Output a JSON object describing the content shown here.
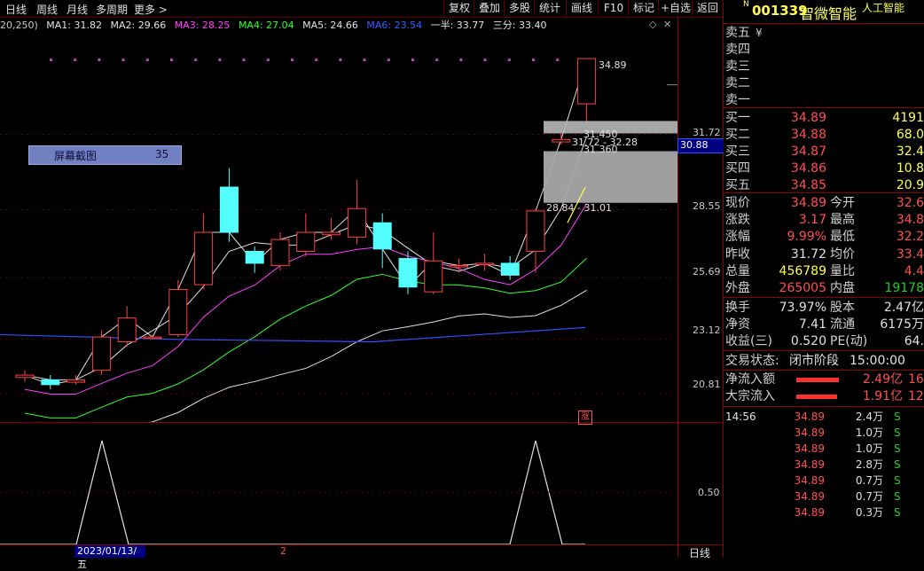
{
  "toolbar": {
    "left_items": [
      "日线",
      "周线",
      "月线",
      "多周期",
      "更多 >"
    ],
    "buttons": [
      "复权",
      "叠加",
      "多股",
      "统计",
      "画线",
      "F10",
      "标记",
      "+自选",
      "返回"
    ]
  },
  "indicators": {
    "prefix": "20,250)",
    "items": [
      {
        "label": "MA1: 31.82",
        "color": "#e0e0e0"
      },
      {
        "label": "MA2: 29.66",
        "color": "#e0e0e0"
      },
      {
        "label": "MA3: 28.25",
        "color": "#ff40ff"
      },
      {
        "label": "MA4: 27.04",
        "color": "#30ff30"
      },
      {
        "label": "MA5: 24.66",
        "color": "#e0e0e0"
      },
      {
        "label": "MA6: 23.54",
        "color": "#3060ff"
      },
      {
        "label": "一半: 33.77",
        "color": "#e0e0e0"
      },
      {
        "label": "三分: 33.40",
        "color": "#e0e0e0"
      }
    ]
  },
  "price_axis": {
    "labels": [
      "31.72",
      "30.88",
      "28.55",
      "25.69",
      "23.12",
      "20.81"
    ]
  },
  "sub_axis": {
    "label": "0.50"
  },
  "annotations": {
    "high": "34.89",
    "level1": "31.450",
    "level2": "31.72 - 32.28",
    "level3": "31.360",
    "range": "28.84 - 31.01",
    "tooltip_label": "屏幕截图",
    "tooltip_value": "35",
    "limit_mark": "涨",
    "date_label": "2023/01/13/五",
    "month_label": "2",
    "period_label": "日线"
  },
  "chart_data": {
    "type": "candlestick",
    "candles": [
      {
        "o": 21.5,
        "c": 21.6,
        "h": 21.8,
        "l": 21.3
      },
      {
        "o": 21.4,
        "c": 21.2,
        "h": 21.6,
        "l": 21.0
      },
      {
        "o": 21.3,
        "c": 21.4,
        "h": 21.6,
        "l": 21.2
      },
      {
        "o": 21.8,
        "c": 23.2,
        "h": 23.5,
        "l": 21.6
      },
      {
        "o": 23.0,
        "c": 24.0,
        "h": 24.5,
        "l": 22.8
      },
      {
        "o": 23.2,
        "c": 23.2,
        "h": 23.3,
        "l": 23.1
      },
      {
        "o": 23.3,
        "c": 25.2,
        "h": 25.6,
        "l": 23.2
      },
      {
        "o": 25.4,
        "c": 27.6,
        "h": 28.4,
        "l": 25.2
      },
      {
        "o": 29.5,
        "c": 27.6,
        "h": 30.3,
        "l": 27.2
      },
      {
        "o": 26.8,
        "c": 26.3,
        "h": 27.0,
        "l": 25.9
      },
      {
        "o": 26.2,
        "c": 27.3,
        "h": 27.6,
        "l": 26.0
      },
      {
        "o": 26.8,
        "c": 27.6,
        "h": 28.4,
        "l": 26.6
      },
      {
        "o": 27.5,
        "c": 27.6,
        "h": 28.2,
        "l": 27.3
      },
      {
        "o": 27.4,
        "c": 28.6,
        "h": 29.8,
        "l": 27.1
      },
      {
        "o": 28.0,
        "c": 26.9,
        "h": 28.4,
        "l": 26.1
      },
      {
        "o": 26.5,
        "c": 25.3,
        "h": 26.8,
        "l": 25.0
      },
      {
        "o": 25.1,
        "c": 26.4,
        "h": 27.6,
        "l": 25.0
      },
      {
        "o": 26.2,
        "c": 26.2,
        "h": 26.5,
        "l": 25.9
      },
      {
        "o": 26.3,
        "c": 26.3,
        "h": 26.7,
        "l": 26.0
      },
      {
        "o": 26.3,
        "c": 25.8,
        "h": 26.6,
        "l": 25.6
      },
      {
        "o": 26.8,
        "c": 28.5,
        "h": 28.6,
        "l": 25.9
      },
      {
        "o": 31.4,
        "c": 31.5,
        "h": 31.8,
        "l": 31.3
      },
      {
        "o": 33.0,
        "c": 34.9,
        "h": 34.9,
        "l": 32.2
      }
    ],
    "ylim": [
      20.0,
      35.5
    ]
  },
  "right_panel": {
    "code": "001339",
    "name": "智微智能",
    "tag": "人工智能",
    "sell_levels": [
      "卖五",
      "卖四",
      "卖三",
      "卖二",
      "卖一"
    ],
    "buy_levels": [
      {
        "label": "买一",
        "price": "34.89",
        "vol": "4191"
      },
      {
        "label": "买二",
        "price": "34.88",
        "vol": "68.0"
      },
      {
        "label": "买三",
        "price": "34.87",
        "vol": "32.4"
      },
      {
        "label": "买四",
        "price": "34.86",
        "vol": "10.8"
      },
      {
        "label": "买五",
        "price": "34.85",
        "vol": "20.9"
      }
    ],
    "stats": [
      {
        "l1": "现价",
        "v1": "34.89",
        "c1": "red",
        "l2": "今开",
        "v2": "32.6",
        "c2": "red"
      },
      {
        "l1": "涨跌",
        "v1": "3.17",
        "c1": "red",
        "l2": "最高",
        "v2": "34.8",
        "c2": "red"
      },
      {
        "l1": "涨幅",
        "v1": "9.99%",
        "c1": "red",
        "l2": "最低",
        "v2": "32.2",
        "c2": "red"
      },
      {
        "l1": "昨收",
        "v1": "31.72",
        "c1": "white",
        "l2": "均价",
        "v2": "33.4",
        "c2": "red"
      },
      {
        "l1": "总量",
        "v1": "456789",
        "c1": "yellow",
        "l2": "量比",
        "v2": "4.4",
        "c2": "red"
      },
      {
        "l1": "外盘",
        "v1": "265005",
        "c1": "red",
        "l2": "内盘",
        "v2": "19178",
        "c2": "green"
      }
    ],
    "stats2": [
      {
        "l1": "换手",
        "v1": "73.97%",
        "l2": "股本",
        "v2": "2.47亿"
      },
      {
        "l1": "净资",
        "v1": "7.41",
        "l2": "流通",
        "v2": "6175万"
      },
      {
        "l1": "收益(三)",
        "v1": "0.520",
        "l2": "PE(动)",
        "v2": "64."
      }
    ],
    "status_label": "交易状态:",
    "status_value": "闭市阶段",
    "status_time": "15:00:00",
    "flows": [
      {
        "label": "净流入额",
        "value": "2.49亿",
        "extra": "16"
      },
      {
        "label": "大宗流入",
        "value": "1.91亿",
        "extra": "12"
      }
    ],
    "trades": [
      {
        "time": "14:56",
        "price": "34.89",
        "vol": "2.4万",
        "side": "S"
      },
      {
        "time": "",
        "price": "34.89",
        "vol": "1.0万",
        "side": "S"
      },
      {
        "time": "",
        "price": "34.89",
        "vol": "1.0万",
        "side": "S"
      },
      {
        "time": "",
        "price": "34.89",
        "vol": "2.8万",
        "side": "S"
      },
      {
        "time": "",
        "price": "34.89",
        "vol": "0.7万",
        "side": "S"
      },
      {
        "time": "",
        "price": "34.89",
        "vol": "0.7万",
        "side": "S"
      },
      {
        "time": "",
        "price": "34.89",
        "vol": "0.3万",
        "side": "S"
      }
    ]
  }
}
